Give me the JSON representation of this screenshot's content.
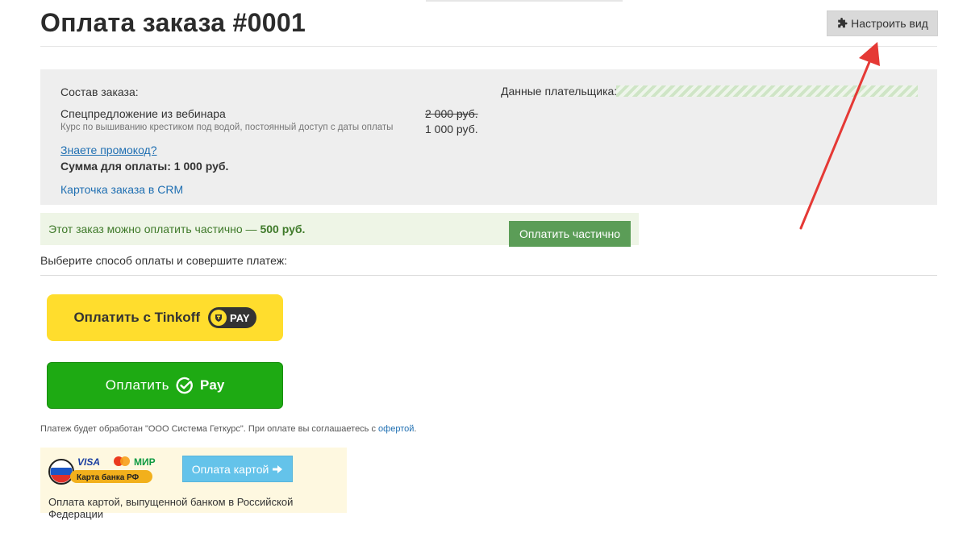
{
  "header": {
    "title": "Оплата заказа #0001",
    "customize_label": "Настроить вид"
  },
  "order": {
    "heading": "Состав заказа:",
    "item_name": "Спецпредложение из вебинара",
    "item_desc": "Курс по вышиванию крестиком под водой, постоянный доступ с даты оплаты",
    "price_old": "2 000 руб.",
    "price_new": "1 000 руб.",
    "promo_link": "Знаете промокод?",
    "total": "Сумма для оплаты: 1 000 руб.",
    "crm_link": "Карточка заказа в CRM",
    "payer_label": "Данные плательщика:"
  },
  "partial": {
    "text_prefix": "Этот заказ можно оплатить частично — ",
    "amount": "500 руб.",
    "button_label": "Оплатить частично"
  },
  "payment": {
    "choose_label": "Выберите способ оплаты и совершите платеж:",
    "tinkoff_label": "Оплатить с Tinkoff",
    "tinkoff_pay": "PAY",
    "sber_label": "Оплатить",
    "sber_pay": "Pay",
    "processor_note": "Платеж будет обработан \"ООО Система Геткурс\". При оплате вы соглашаетесь с ",
    "offer_link": "офертой",
    "offer_suffix": "."
  },
  "card": {
    "logo_visa": "VISA",
    "logo_mir": "МИР",
    "logo_caption": "Карта банка РФ",
    "button_label": "Оплата картой",
    "note": "Оплата картой, выпущенной банком в Российской Федерации"
  },
  "colors": {
    "tinkoff_yellow": "#ffdd2d",
    "sber_green": "#1eaa13",
    "partial_button": "#5b9d57",
    "card_button": "#64c3ea",
    "link_blue": "#1f6fb2",
    "annotation_arrow": "#e53935"
  },
  "icons": {
    "customize": "puzzle-icon",
    "sber": "check-circle-icon",
    "card_button": "arrow-right-icon"
  }
}
